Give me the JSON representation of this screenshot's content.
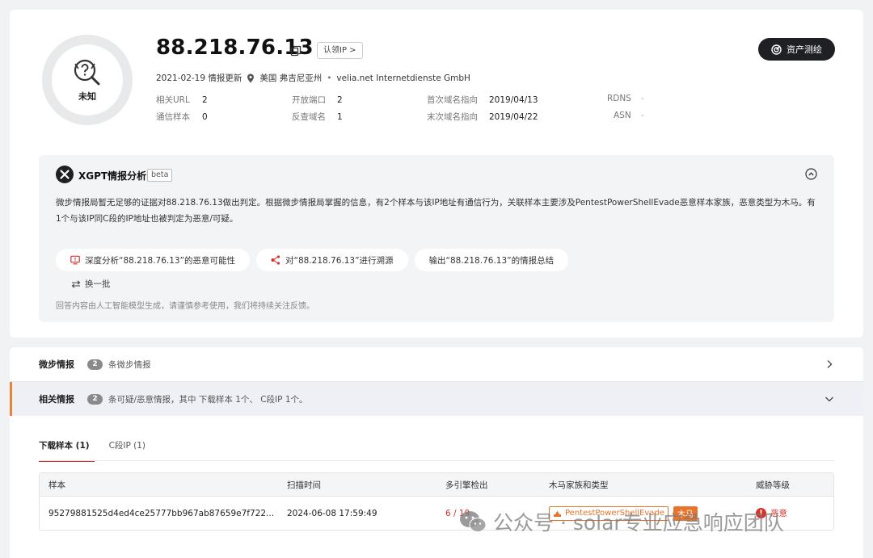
{
  "profile": {
    "verdict": "未知",
    "ip": "88.218.76.13",
    "claim_label": "认领IP >",
    "asset_button": "资产测绘",
    "update_date": "2021-02-19 情报更新",
    "location": "美国 弗吉尼亚州",
    "separator": "•",
    "isp": "velia.net Internetdienste GmbH"
  },
  "stats": [
    {
      "key": "相关URL",
      "value": "2"
    },
    {
      "key": "开放端口",
      "value": "2"
    },
    {
      "key": "首次域名指向",
      "value": "2019/04/13"
    },
    {
      "key": "RDNS",
      "value": "-"
    },
    {
      "key": "通信样本",
      "value": "0"
    },
    {
      "key": "反查域名",
      "value": "1"
    },
    {
      "key": "末次域名指向",
      "value": "2019/04/22"
    },
    {
      "key": "ASN",
      "value": "-"
    }
  ],
  "ai": {
    "title": "XGPT情报分析",
    "beta": "beta",
    "text": "微步情报局暂无足够的证据对88.218.76.13做出判定。根据微步情报局掌握的信息，有2个样本与该IP地址有通信行为，关联样本主要涉及PentestPowerShellEvade恶意样本家族，恶意类型为木马。有1个与该IP同C段的IP地址也被判定为恶意/可疑。",
    "chips": [
      "深度分析“88.218.76.13”的恶意可能性",
      "对“88.218.76.13”进行溯源",
      "输出“88.218.76.13”的情报总结"
    ],
    "refresh": "换一批",
    "disclaimer": "回答内容由人工智能模型生成，请谨慎参考使用，我们将持续关注反馈。"
  },
  "sections": [
    {
      "title": "微步情报",
      "count": "2",
      "desc": "条微步情报"
    },
    {
      "title": "相关情报",
      "count": "2",
      "desc": "条可疑/恶意情报，其中 下载样本 1个、 C段IP 1个。"
    }
  ],
  "tabs": [
    "下载样本 (1)",
    "C段IP (1)"
  ],
  "table": {
    "headers": [
      "样本",
      "扫描时间",
      "多引擎检出",
      "木马家族和类型",
      "威胁等级"
    ],
    "rows": [
      {
        "sample": "95279881525d4ed4ce25777bb967ab87659e7f722...",
        "time": "2024-06-08 17:59:49",
        "detect": "6 / 19",
        "family": "PentestPowerShellEvade",
        "type": "木马",
        "threat": "恶意"
      }
    ]
  },
  "watermark": "公众号 · solar专业应急响应团队"
}
